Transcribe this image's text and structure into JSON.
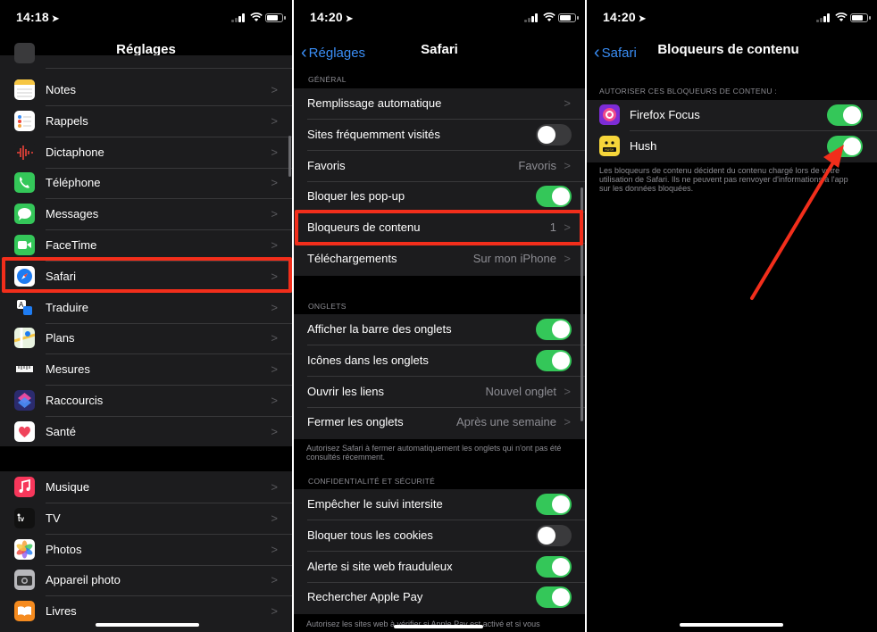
{
  "panel1": {
    "time": "14:18",
    "title": "Réglages",
    "items": [
      {
        "label": "Notes",
        "icon": "notes-icon"
      },
      {
        "label": "Rappels",
        "icon": "reminders-icon"
      },
      {
        "label": "Dictaphone",
        "icon": "voice-memos-icon"
      },
      {
        "label": "Téléphone",
        "icon": "phone-icon"
      },
      {
        "label": "Messages",
        "icon": "messages-icon"
      },
      {
        "label": "FaceTime",
        "icon": "facetime-icon"
      },
      {
        "label": "Safari",
        "icon": "safari-icon"
      },
      {
        "label": "Traduire",
        "icon": "translate-icon"
      },
      {
        "label": "Plans",
        "icon": "maps-icon"
      },
      {
        "label": "Mesures",
        "icon": "measure-icon"
      },
      {
        "label": "Raccourcis",
        "icon": "shortcuts-icon"
      },
      {
        "label": "Santé",
        "icon": "health-icon"
      }
    ],
    "items2": [
      {
        "label": "Musique",
        "icon": "music-icon"
      },
      {
        "label": "TV",
        "icon": "tv-icon"
      },
      {
        "label": "Photos",
        "icon": "photos-icon"
      },
      {
        "label": "Appareil photo",
        "icon": "camera-icon"
      },
      {
        "label": "Livres",
        "icon": "books-icon"
      }
    ]
  },
  "panel2": {
    "time": "14:20",
    "back": "Réglages",
    "title": "Safari",
    "general_header": "GÉNÉRAL",
    "general": [
      {
        "label": "Remplissage automatique",
        "value": "",
        "kind": "chevron"
      },
      {
        "label": "Sites fréquemment visités",
        "kind": "toggle",
        "on": false
      },
      {
        "label": "Favoris",
        "value": "Favoris",
        "kind": "chevron"
      },
      {
        "label": "Bloquer les pop-up",
        "kind": "toggle",
        "on": true
      },
      {
        "label": "Bloqueurs de contenu",
        "value": "1",
        "kind": "chevron"
      },
      {
        "label": "Téléchargements",
        "value": "Sur mon iPhone",
        "kind": "chevron"
      }
    ],
    "tabs_header": "ONGLETS",
    "tabs": [
      {
        "label": "Afficher la barre des onglets",
        "kind": "toggle",
        "on": true
      },
      {
        "label": "Icônes dans les onglets",
        "kind": "toggle",
        "on": true
      },
      {
        "label": "Ouvrir les liens",
        "value": "Nouvel onglet",
        "kind": "chevron"
      },
      {
        "label": "Fermer les onglets",
        "value": "Après une semaine",
        "kind": "chevron"
      }
    ],
    "tabs_footer": "Autorisez Safari à fermer automatiquement les onglets qui n'ont pas été consultés récemment.",
    "privacy_header": "CONFIDENTIALITÉ ET SÉCURITÉ",
    "privacy": [
      {
        "label": "Empêcher le suivi intersite",
        "kind": "toggle",
        "on": true
      },
      {
        "label": "Bloquer tous les cookies",
        "kind": "toggle",
        "on": false
      },
      {
        "label": "Alerte si site web frauduleux",
        "kind": "toggle",
        "on": true
      },
      {
        "label": "Rechercher Apple Pay",
        "kind": "toggle",
        "on": true
      }
    ],
    "privacy_footer": "Autorisez les sites web à vérifier si Apple Pay est activé et si vous"
  },
  "panel3": {
    "time": "14:20",
    "back": "Safari",
    "title": "Bloqueurs de contenu",
    "header": "AUTORISER CES BLOQUEURS DE CONTENU :",
    "blockers": [
      {
        "label": "Firefox Focus",
        "on": true,
        "icon": "firefox-focus-icon"
      },
      {
        "label": "Hush",
        "on": true,
        "icon": "hush-icon"
      }
    ],
    "footer": "Les bloqueurs de contenu décident du contenu chargé lors de votre utilisation de Safari. Ils ne peuvent pas renvoyer d'informations à l'app sur les données bloquées."
  },
  "annotation": {
    "color": "#f22e1b"
  }
}
